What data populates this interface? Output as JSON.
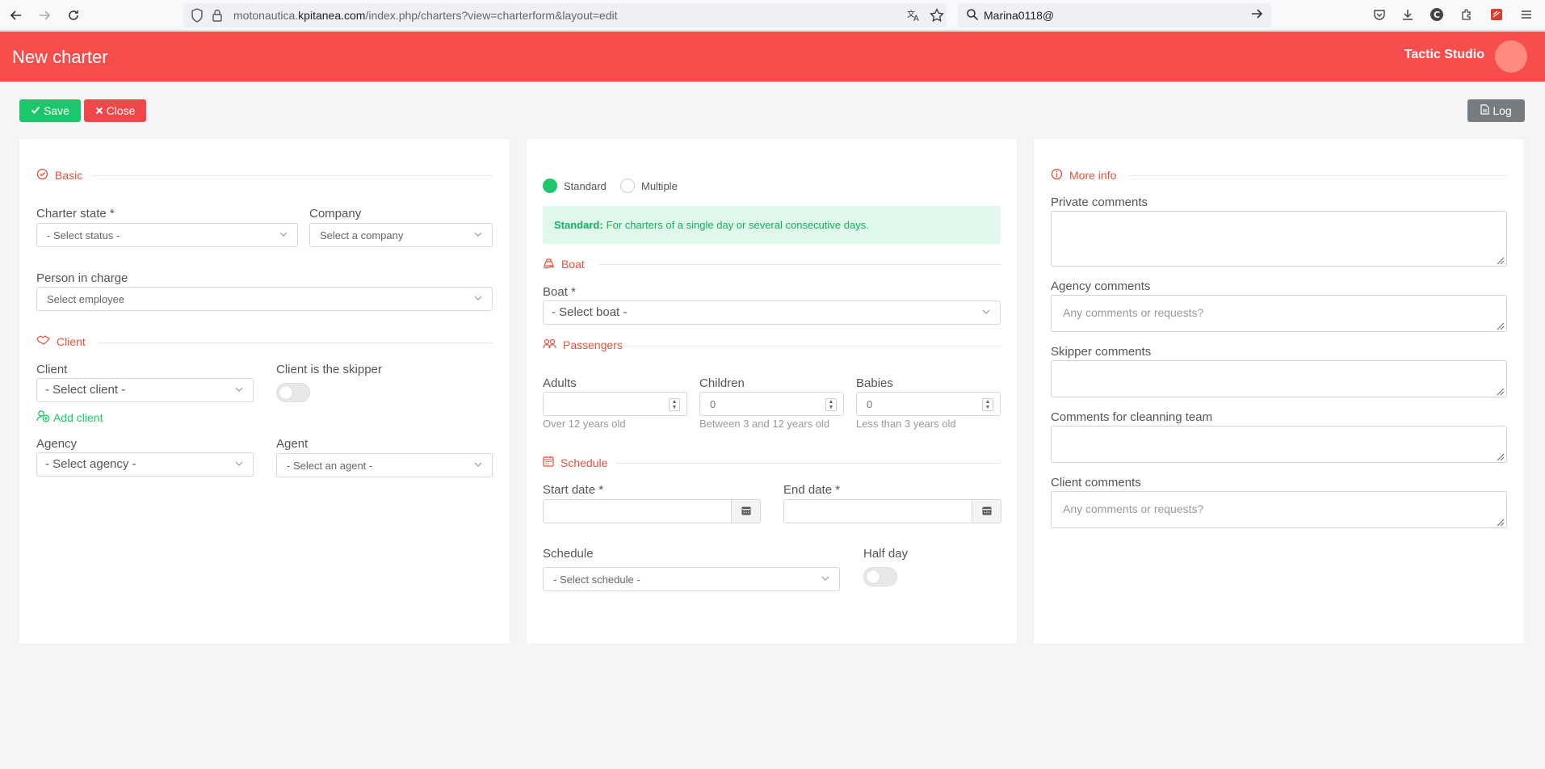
{
  "browser": {
    "url_prefix": "motonautica.",
    "url_domain": "kpitanea.com",
    "url_path": "/index.php/charters?view=charterform&layout=edit",
    "search_text": "Marina0118@"
  },
  "header": {
    "title": "New charter",
    "studio": "Tactic Studio"
  },
  "actions": {
    "save": "Save",
    "close": "Close",
    "log": "Log"
  },
  "basic": {
    "section": "Basic",
    "charter_state_label": "Charter state *",
    "charter_state_value": "- Select status -",
    "company_label": "Company",
    "company_value": "Select a company",
    "person_label": "Person in charge",
    "person_value": "Select employee"
  },
  "client": {
    "section": "Client",
    "client_label": "Client",
    "client_value": "- Select client -",
    "skipper_label": "Client is the skipper",
    "add_client": "Add client",
    "agency_label": "Agency",
    "agency_value": "- Select agency -",
    "agent_label": "Agent",
    "agent_value": "- Select an agent -"
  },
  "mode": {
    "standard": "Standard",
    "multiple": "Multiple",
    "alert_bold": "Standard:",
    "alert_text": "For charters of a single day or several consecutive days."
  },
  "boat": {
    "section": "Boat",
    "boat_label": "Boat *",
    "boat_value": "- Select boat -"
  },
  "passengers": {
    "section": "Passengers",
    "adults_label": "Adults",
    "adults_value": "",
    "adults_hint": "Over 12 years old",
    "children_label": "Children",
    "children_value": "0",
    "children_hint": "Between 3 and 12 years old",
    "babies_label": "Babies",
    "babies_value": "0",
    "babies_hint": "Less than 3 years old"
  },
  "schedule": {
    "section": "Schedule",
    "start_label": "Start date *",
    "end_label": "End date *",
    "schedule_label": "Schedule",
    "schedule_value": "- Select schedule -",
    "half_day_label": "Half day"
  },
  "more_info": {
    "section": "More info",
    "private_label": "Private comments",
    "agency_label": "Agency comments",
    "agency_placeholder": "Any comments or requests?",
    "skipper_label": "Skipper comments",
    "cleaning_label": "Comments for cleanning team",
    "client_label": "Client comments",
    "client_placeholder": "Any comments or requests?"
  },
  "colors": {
    "header": "#f74d4d",
    "accent_red": "#e9503c",
    "success": "#1cc66a"
  }
}
